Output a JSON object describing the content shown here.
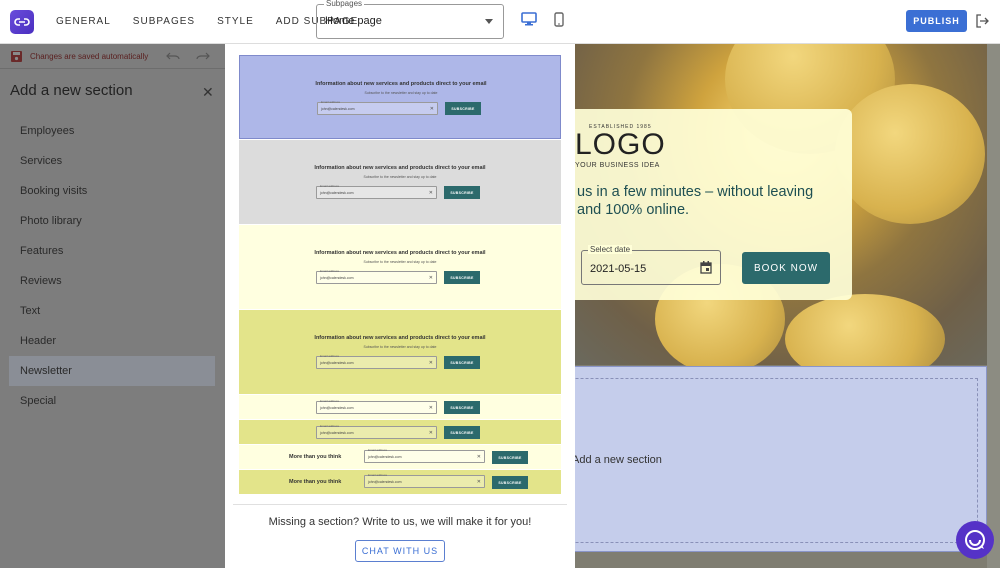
{
  "topbar": {
    "nav": [
      "GENERAL",
      "SUBPAGES",
      "STYLE",
      "ADD SUBPAGE"
    ],
    "subpages_label": "Subpages",
    "subpages_value": "Home page",
    "publish_label": "PUBLISH"
  },
  "leftpanel": {
    "save_status": "Changes are saved automatically",
    "title": "Add a new section",
    "items": [
      "Employees",
      "Services",
      "Booking visits",
      "Photo library",
      "Features",
      "Reviews",
      "Text",
      "Header",
      "Newsletter",
      "Special"
    ],
    "active_item": "Newsletter"
  },
  "picker": {
    "newsletter_heading": "Information about new services and products direct to your email",
    "newsletter_sub": "Subscribe to the newsletter and stay up to date",
    "email_label": "Email address",
    "email_value": "john@calendesk.com",
    "subscribe_label": "SUBSCRIBE",
    "more_text": "More than you think",
    "missing_text": "Missing a section? Write to us, we will make it for you!",
    "chat_label": "CHAT WITH US"
  },
  "preview": {
    "established": "ESTABLISHED 1985",
    "logo_text": "LOGO",
    "business_idea": "YOUR BUSINESS IDEA",
    "tagline": "us in a few minutes – without leaving and 100% online.",
    "date_label": "Select date",
    "date_value": "2021-05-15",
    "book_now": "BOOK NOW",
    "add_section": "Add a new section"
  },
  "colors": {
    "accent": "#3b6fd4",
    "teal": "#2c6a6c",
    "brand": "#5532c7"
  }
}
